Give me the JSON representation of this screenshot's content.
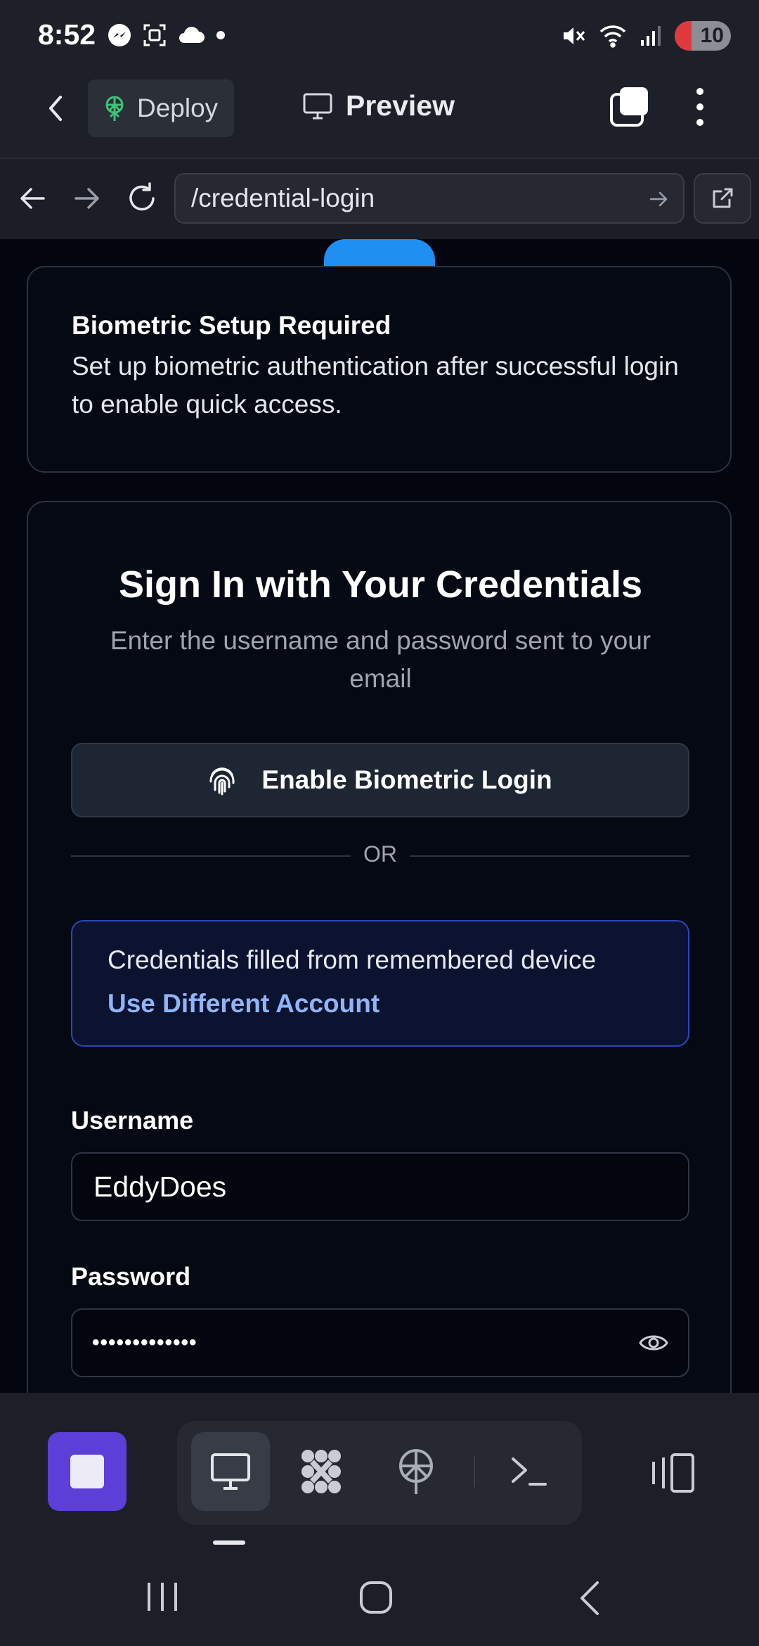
{
  "status_bar": {
    "time": "8:52",
    "battery": "10",
    "left_icons": [
      "messenger-icon",
      "screenshot-icon",
      "cloud-icon",
      "dot-icon"
    ],
    "right_icons": [
      "mute-icon",
      "wifi-icon",
      "signal-icon",
      "battery-icon"
    ]
  },
  "header": {
    "deploy_label": "Deploy",
    "preview_label": "Preview"
  },
  "browser": {
    "url": "/credential-login"
  },
  "setup_card": {
    "title": "Biometric Setup Required",
    "text": "Set up biometric authentication after successful login to enable quick access."
  },
  "login": {
    "title": "Sign In with Your Credentials",
    "subtitle": "Enter the username and password sent to your email",
    "biometric_button": "Enable Biometric Login",
    "or_text": "OR",
    "remembered_text": "Credentials filled from remembered device",
    "different_account_link": "Use Different Account",
    "username_label": "Username",
    "username_value": "EddyDoes",
    "password_label": "Password",
    "password_masked": "•••••••••••••"
  },
  "colors": {
    "accent_purple": "#5b3fd6",
    "accent_blue": "#1f8ff2",
    "link_blue": "#8fb5f8",
    "content_bg": "#03060f"
  }
}
